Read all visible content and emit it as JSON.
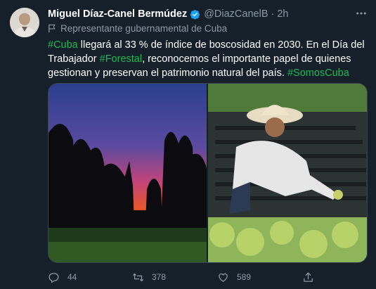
{
  "tweet": {
    "author_name": "Miguel Díaz-Canel Bermúdez",
    "handle": "@DiazCanelB",
    "separator": "·",
    "time": "2h",
    "more_icon": "more-dots-icon",
    "gov_label": "Representante gubernamental de Cuba",
    "text_segments": [
      {
        "kind": "tag",
        "text": "#Cuba"
      },
      {
        "kind": "plain",
        "text": " llegará al 33 % de índice de boscosidad en 2030.  En el Día del Trabajador "
      },
      {
        "kind": "tag",
        "text": "#Forestal"
      },
      {
        "kind": "plain",
        "text": ", reconocemos el importante papel de quienes gestionan y preservan el patrimonio natural del país. "
      },
      {
        "kind": "tag",
        "text": "#SomosCuba"
      }
    ],
    "actions": {
      "replies": "44",
      "retweets": "378",
      "likes": "589"
    }
  },
  "colors": {
    "background": "#15202b",
    "muted": "#8899a6",
    "hashtag": "#1db954",
    "verified": "#1da1f2"
  }
}
